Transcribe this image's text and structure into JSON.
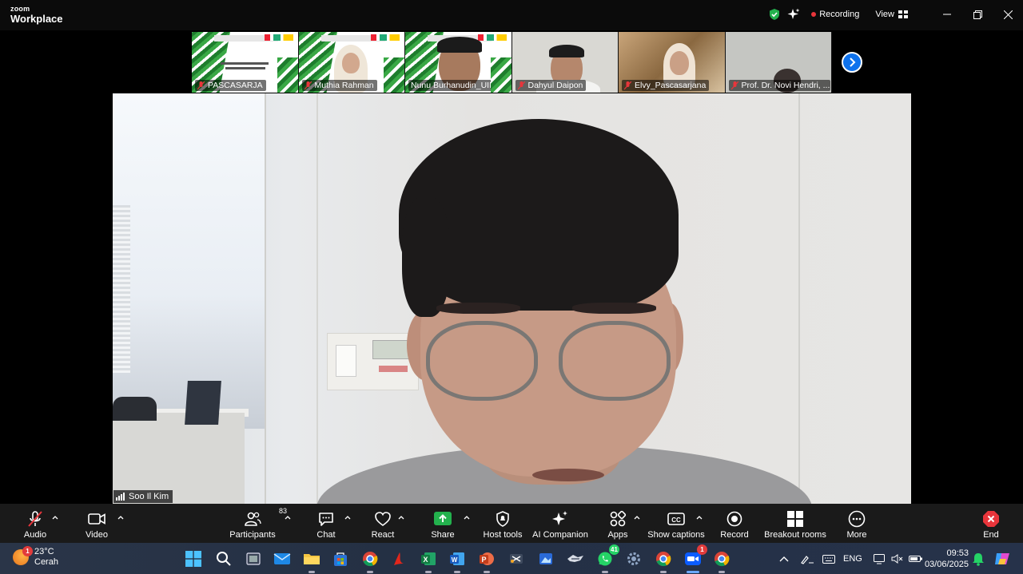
{
  "titlebar": {
    "logo_line1": "zoom",
    "logo_line2": "Workplace",
    "recording_label": "Recording",
    "view_label": "View",
    "colors": {
      "recording_dot": "#e8353b",
      "shield": "#23b14d"
    }
  },
  "gallery": {
    "tiles": [
      {
        "name": "PASCASARJA",
        "kind": "slide",
        "muted": true
      },
      {
        "name": "Muthia Rahman",
        "kind": "slide-person",
        "muted": true
      },
      {
        "name": "Nunu Burhanudin_UIN Bu...",
        "kind": "slide-person",
        "muted": false
      },
      {
        "name": "Dahyul Daipon",
        "kind": "person",
        "muted": true
      },
      {
        "name": "Elvy_Pascasarjana",
        "kind": "person",
        "muted": true
      },
      {
        "name": "Prof. Dr. Novi Hendri, ...",
        "kind": "person",
        "muted": true
      }
    ],
    "next_icon": "chevron-right-icon"
  },
  "main_video": {
    "speaker_name": "Soo Il Kim"
  },
  "toolbar": {
    "audio": "Audio",
    "video": "Video",
    "participants": "Participants",
    "participants_count": "83",
    "chat": "Chat",
    "react": "React",
    "share": "Share",
    "host_tools": "Host tools",
    "ai_companion": "AI Companion",
    "apps": "Apps",
    "show_captions": "Show captions",
    "record": "Record",
    "breakout_rooms": "Breakout rooms",
    "more": "More",
    "end": "End",
    "colors": {
      "share": "#23b14d",
      "end": "#e8353b"
    }
  },
  "taskbar": {
    "weather_temp": "23°C",
    "weather_desc": "Cerah",
    "weather_badge": "1",
    "whatsapp_badge": "41",
    "zoom_badge": "1",
    "language": "ENG",
    "time": "09:53",
    "date": "03/06/2025"
  }
}
